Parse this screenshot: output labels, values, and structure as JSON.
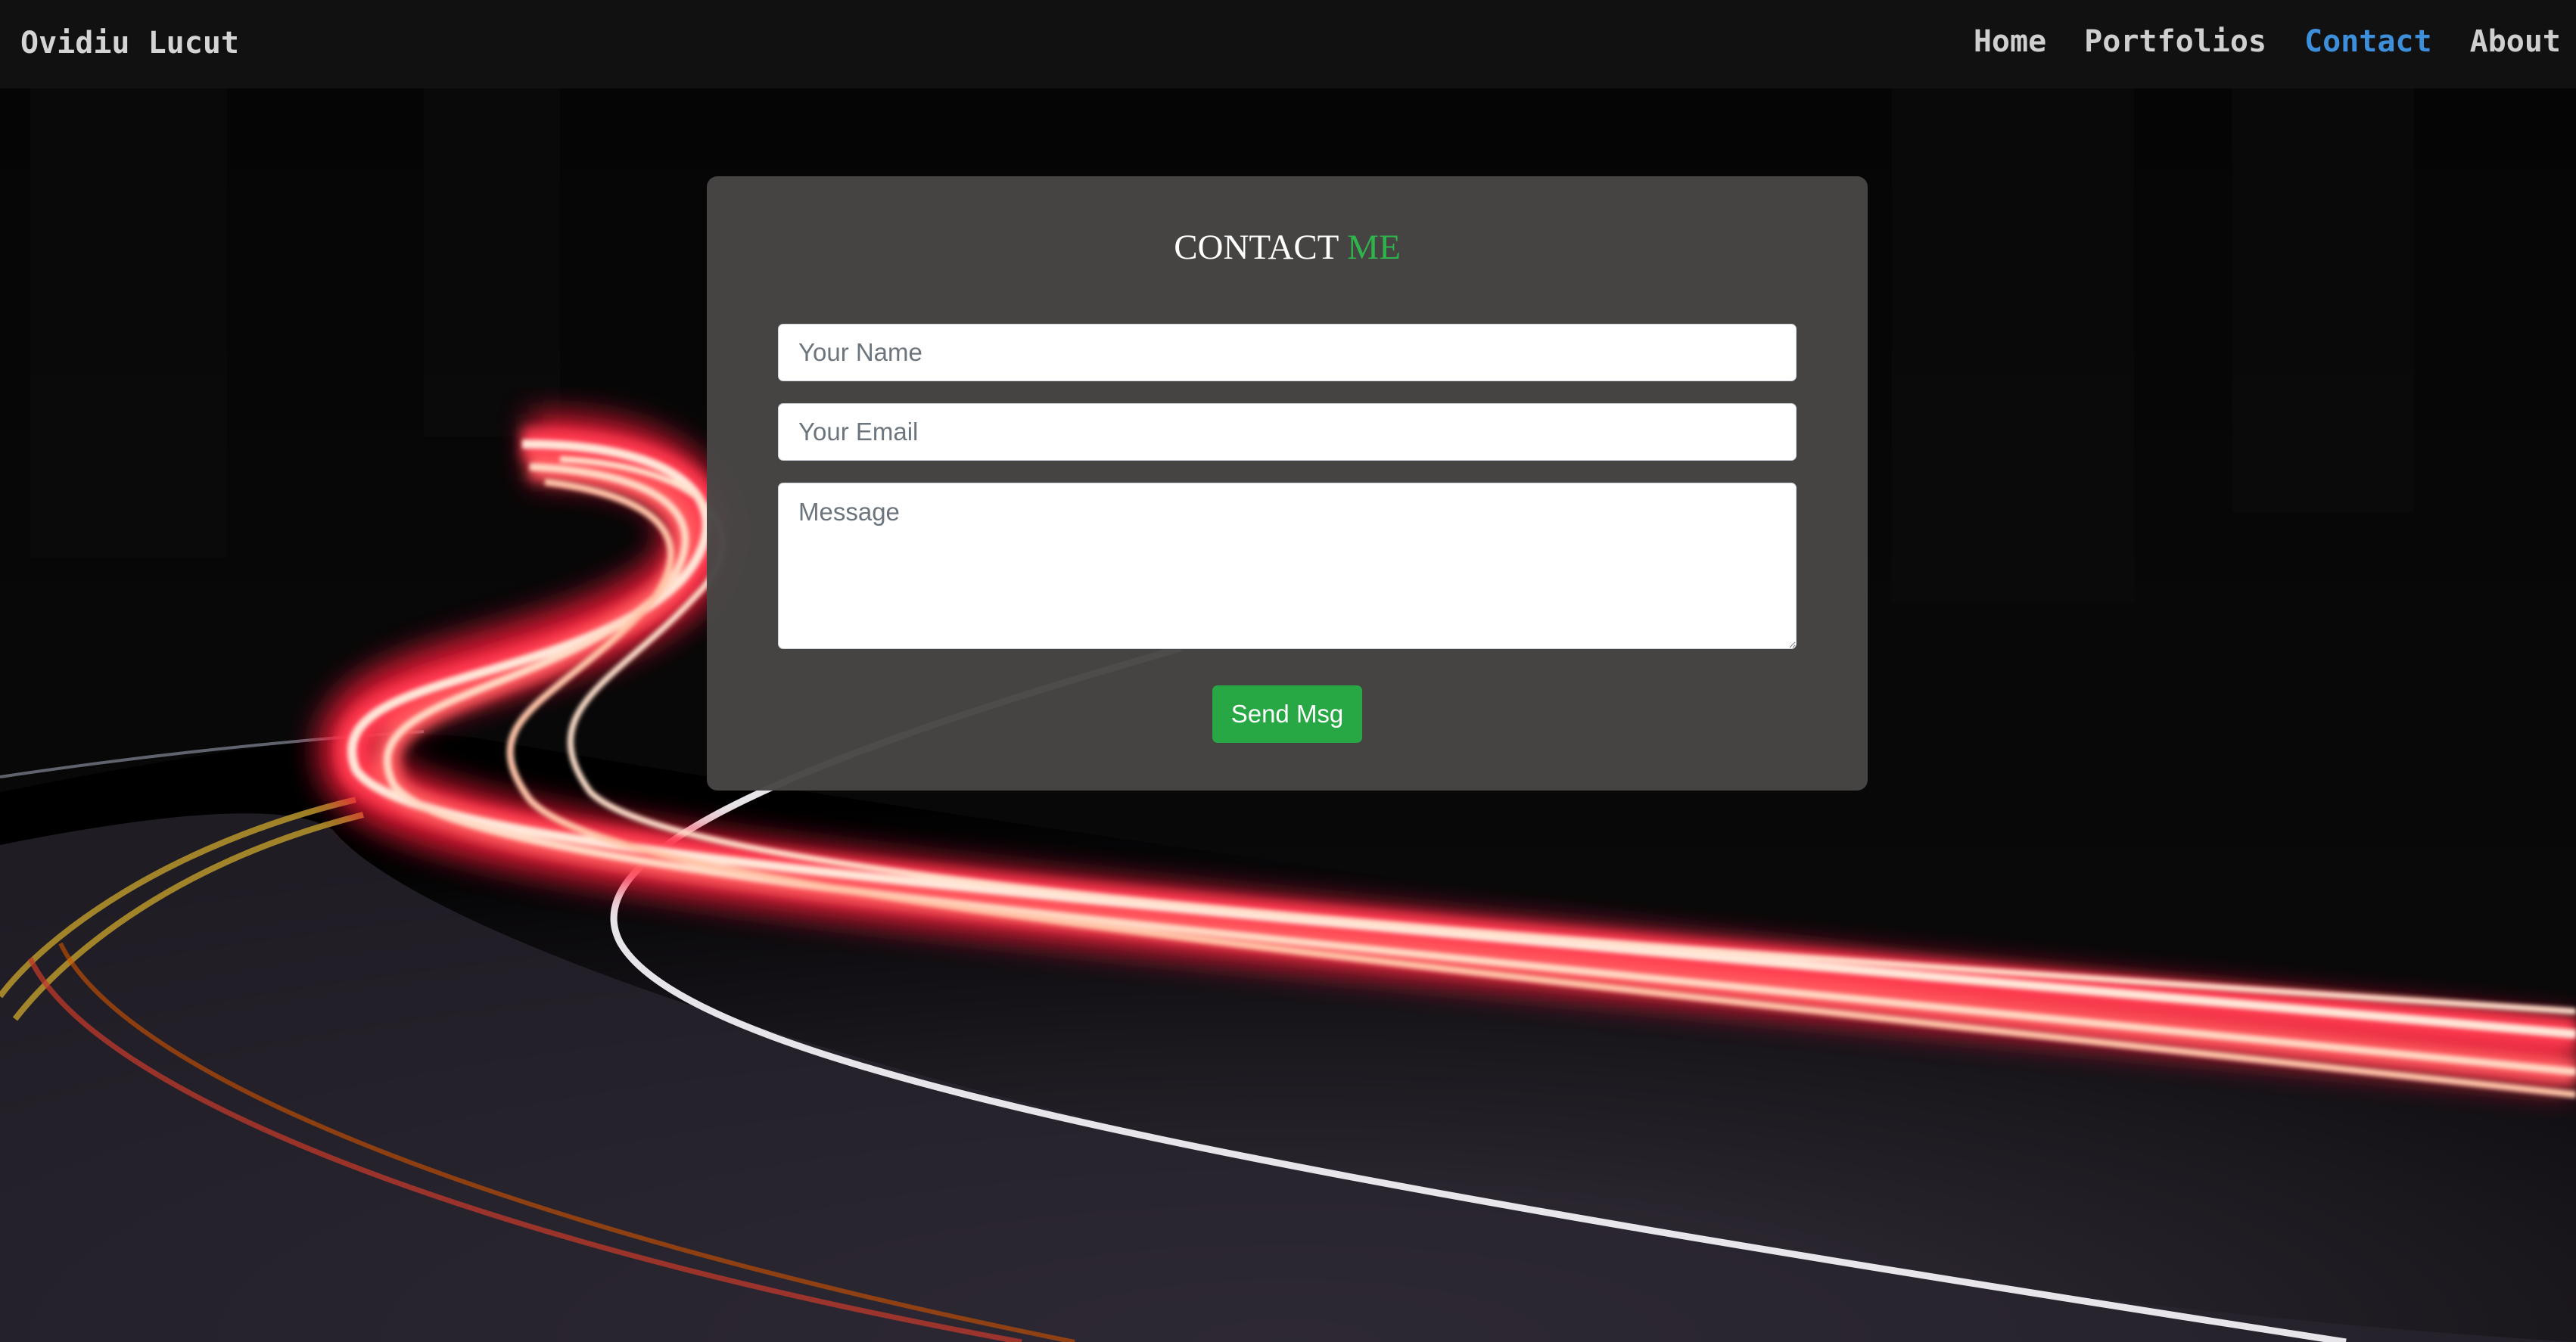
{
  "navbar": {
    "brand": "Ovidiu Lucut",
    "links": [
      {
        "label": "Home"
      },
      {
        "label": "Portfolios"
      },
      {
        "label": "Contact",
        "active": true
      },
      {
        "label": "About"
      }
    ],
    "active_color": "#3d8fdc"
  },
  "background": {
    "icon": "light-trails-road-photo"
  },
  "contact": {
    "title_main": "CONTACT",
    "title_accent": "ME",
    "accent_color": "#2fb34b",
    "name_placeholder": "Your Name",
    "email_placeholder": "Your Email",
    "message_placeholder": "Message",
    "send_label": "Send Msg",
    "button_color": "#28a745"
  }
}
